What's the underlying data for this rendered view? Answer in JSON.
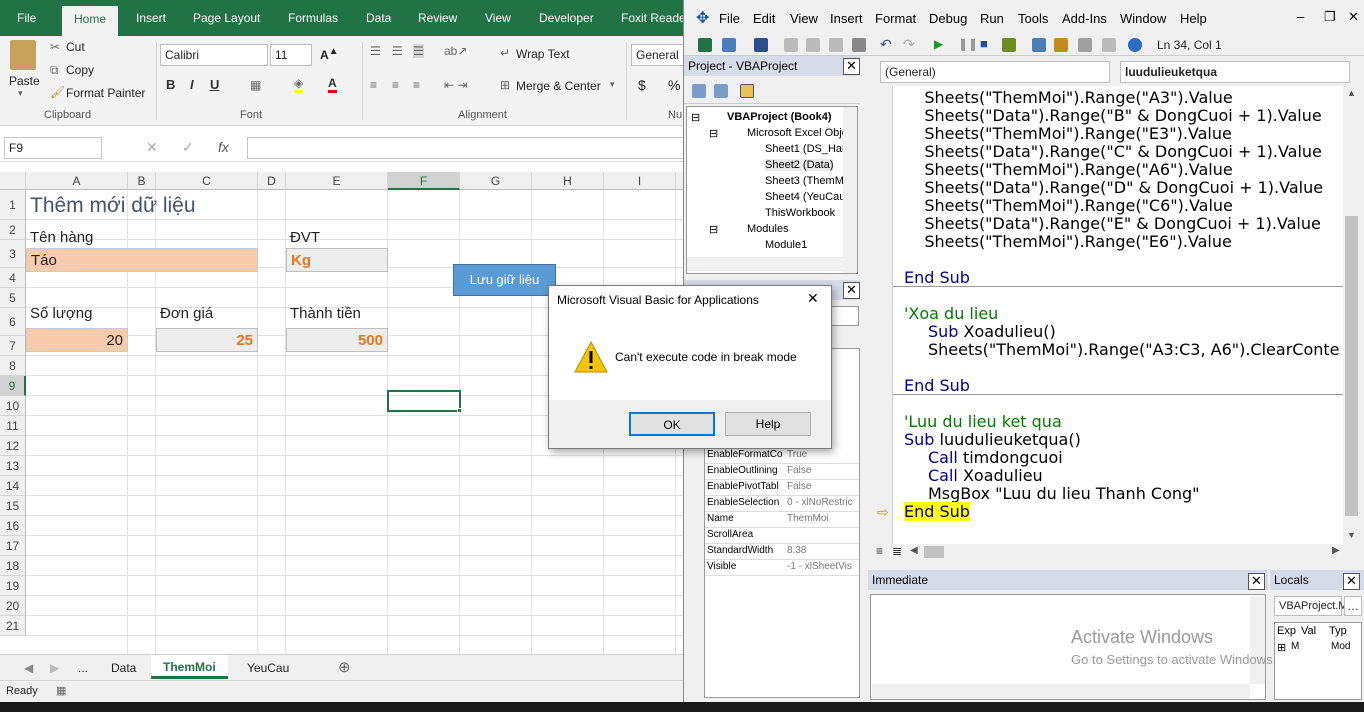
{
  "excel": {
    "tabs": [
      "File",
      "Home",
      "Insert",
      "Page Layout",
      "Formulas",
      "Data",
      "Review",
      "View",
      "Developer",
      "Foxit Reade"
    ],
    "clipboard": {
      "paste": "Paste",
      "cut": "Cut",
      "copy": "Copy",
      "format_painter": "Format Painter",
      "group": "Clipboard"
    },
    "font": {
      "name": "Calibri",
      "size": "11",
      "bold": "B",
      "italic": "I",
      "underline": "U",
      "group": "Font"
    },
    "alignment": {
      "wrap": "Wrap Text",
      "merge": "Merge & Center",
      "group": "Alignment"
    },
    "number": {
      "format": "General",
      "currency": "$",
      "percent": "%",
      "group": "Nu"
    },
    "name_box": "F9",
    "fx": "fx",
    "columns": [
      "A",
      "B",
      "C",
      "D",
      "E",
      "F",
      "G",
      "H",
      "I"
    ],
    "rows": [
      "1",
      "2",
      "3",
      "4",
      "5",
      "6",
      "7",
      "8",
      "9",
      "10",
      "11",
      "12",
      "13",
      "14",
      "15",
      "16",
      "17",
      "18",
      "19",
      "20",
      "21"
    ],
    "cells": {
      "a1": "Thêm mới dữ liệu",
      "a2": "Tên hàng",
      "e2": "ĐVT",
      "a3": "Táo",
      "e3": "Kg",
      "a5": "Số lượng",
      "c5": "Đơn giá",
      "e5": "Thành tiền",
      "a6": "20",
      "c6": "25",
      "e6": "500"
    },
    "save_button": "Lưu giữ liệu",
    "sheet_tabs": [
      "...",
      "Data",
      "ThemMoi",
      "YeuCau"
    ],
    "status": "Ready"
  },
  "vbe": {
    "menu": [
      "File",
      "Edit",
      "View",
      "Insert",
      "Format",
      "Debug",
      "Run",
      "Tools",
      "Add-Ins",
      "Window",
      "Help"
    ],
    "position": "Ln 34, Col 1",
    "project_title": "Project - VBAProject",
    "tree": [
      "VBAProject (Book4)",
      "Microsoft Excel Obje",
      "Sheet1 (DS_Han",
      "Sheet2 (Data)",
      "Sheet3 (ThemMo",
      "Sheet4 (YeuCau",
      "ThisWorkbook",
      "Modules",
      "Module1"
    ],
    "properties": [
      {
        "name": "EnableFormatCo",
        "value": "True"
      },
      {
        "name": "EnableOutlining",
        "value": "False"
      },
      {
        "name": "EnablePivotTabl",
        "value": "False"
      },
      {
        "name": "EnableSelection",
        "value": "0 - xlNoRestric"
      },
      {
        "name": "Name",
        "value": "ThemMoi"
      },
      {
        "name": "ScrollArea",
        "value": ""
      },
      {
        "name": "StandardWidth",
        "value": "8.38"
      },
      {
        "name": "Visible",
        "value": "-1 - xlSheetVis"
      }
    ],
    "object_combo": "(General)",
    "proc_combo": "luudulieuketqua",
    "code_lines": [
      "    Sheets(\"ThemMoi\").Range(\"A3\").Value",
      "    Sheets(\"Data\").Range(\"B\" & DongCuoi + 1).Value",
      "    Sheets(\"ThemMoi\").Range(\"E3\").Value",
      "    Sheets(\"Data\").Range(\"C\" & DongCuoi + 1).Value",
      "    Sheets(\"ThemMoi\").Range(\"A6\").Value",
      "    Sheets(\"Data\").Range(\"D\" & DongCuoi + 1).Value",
      "    Sheets(\"ThemMoi\").Range(\"C6\").Value",
      "    Sheets(\"Data\").Range(\"E\" & DongCuoi + 1).Value",
      "    Sheets(\"ThemMoi\").Range(\"E6\").Value"
    ],
    "end_sub": "End Sub",
    "comment_xoa": "'Xoa du lieu",
    "sub_xoa_kw": "Sub",
    "sub_xoa_name": " Xoadulieu()",
    "clear_line": "Sheets(\"ThemMoi\").Range(\"A3:C3, A6\").ClearConte",
    "comment_luu": "'Luu du lieu ket qua",
    "sub_luu_name": " luudulieuketqua()",
    "call_kw": "Call",
    "call1": " timdongcuoi",
    "call2": " Xoadulieu",
    "msgbox": "MsgBox \"Luu du lieu Thanh Cong\"",
    "immediate_title": "Immediate",
    "locals_title": "Locals",
    "locals_combo": "VBAProject.M",
    "locals_cols": [
      "Exp",
      "Val",
      "Typ"
    ],
    "locals_row": [
      "M",
      "Mod"
    ],
    "watermark_title": "Activate Windows",
    "watermark_sub": "Go to Settings to activate Windows."
  },
  "dialog": {
    "title": "Microsoft Visual Basic for Applications",
    "message": "Can't execute code in break mode",
    "ok": "OK",
    "help": "Help"
  },
  "colors": {
    "excel_green": "#217346",
    "cell_orange": "#f8cbad",
    "cell_gray": "#ededed",
    "accent_orange": "#e8751a",
    "break_yellow": "#ffff00"
  }
}
